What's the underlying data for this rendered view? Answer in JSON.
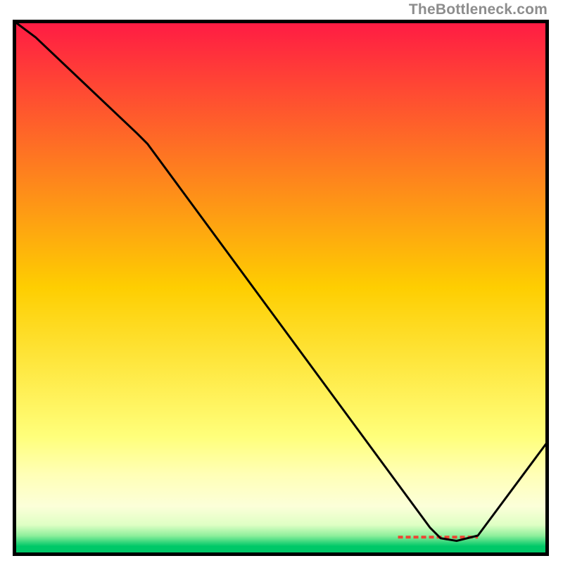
{
  "attribution": "TheBottleneck.com",
  "chart_data": {
    "type": "line",
    "title": "",
    "xlabel": "",
    "ylabel": "",
    "xlim": [
      0,
      100
    ],
    "ylim": [
      0,
      100
    ],
    "grid": false,
    "background_gradient": {
      "stops": [
        {
          "offset": 0.0,
          "color": "#ff1b44"
        },
        {
          "offset": 0.5,
          "color": "#fece01"
        },
        {
          "offset": 0.78,
          "color": "#ffff7b"
        },
        {
          "offset": 0.85,
          "color": "#ffffb6"
        },
        {
          "offset": 0.91,
          "color": "#fcffd9"
        },
        {
          "offset": 0.945,
          "color": "#dfffc4"
        },
        {
          "offset": 0.965,
          "color": "#8fef9c"
        },
        {
          "offset": 0.985,
          "color": "#00c868"
        },
        {
          "offset": 1.0,
          "color": "#00c868"
        }
      ]
    },
    "series": [
      {
        "name": "bottleneck-curve",
        "color": "#000000",
        "x": [
          0,
          4,
          23,
          25,
          78,
          80,
          83,
          87,
          100
        ],
        "values": [
          100,
          97,
          79,
          77,
          5,
          3,
          2.5,
          3.5,
          21
        ]
      }
    ],
    "marker_band": {
      "name": "optimal-range",
      "color": "#ee4433",
      "y": 3.2,
      "x_start": 72,
      "x_end": 87,
      "thickness": 1.2
    }
  }
}
